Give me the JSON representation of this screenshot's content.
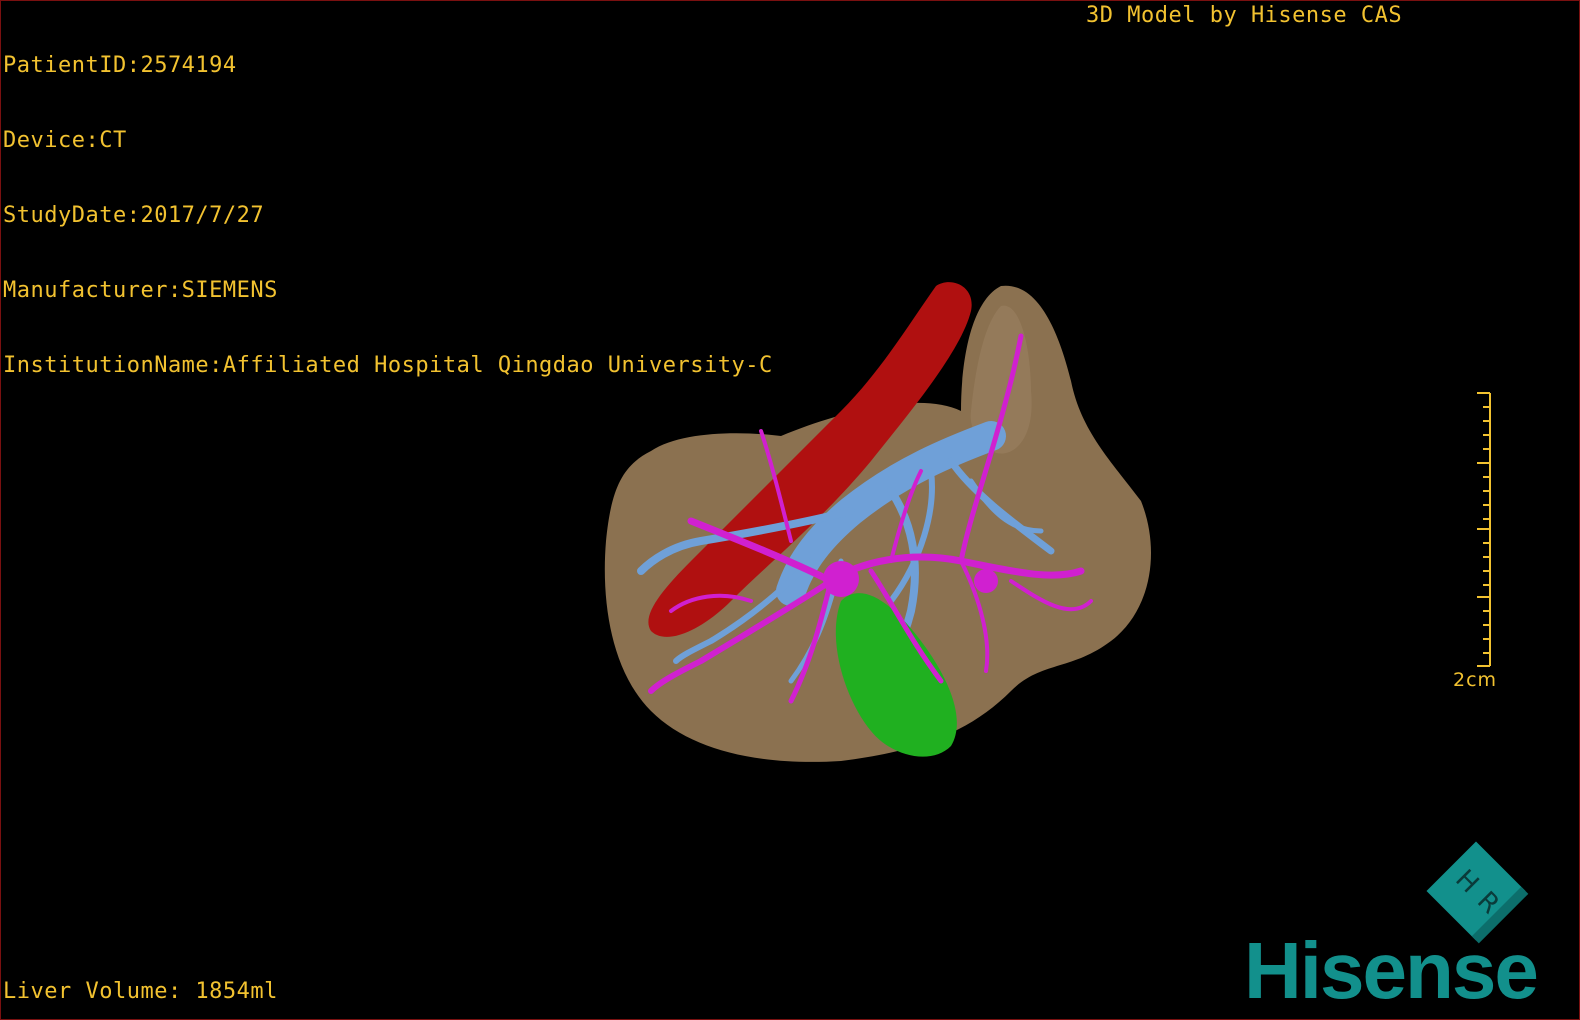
{
  "overlay": {
    "patient_id": "PatientID:2574194",
    "device": "Device:CT",
    "study_date": "StudyDate:2017/7/27",
    "manufacturer": "Manufacturer:SIEMENS",
    "institution": "InstitutionName:Affiliated Hospital Qingdao University-C",
    "credit": "3D Model by Hisense CAS",
    "liver_volume": "Liver Volume: 1854ml"
  },
  "scale": {
    "label": "2cm"
  },
  "orientation_cube": {
    "labels": [
      "H",
      "R"
    ]
  },
  "brand": {
    "name": "Hisense"
  },
  "colors": {
    "overlay_text": "#f2c230",
    "liver": "#8b7150",
    "artery": "#b01010",
    "portal_vein": "#6fa0d8",
    "hepatic_vein": "#d020d0",
    "gallbladder": "#20b020",
    "brand": "#12908c",
    "border": "#7a1010"
  }
}
